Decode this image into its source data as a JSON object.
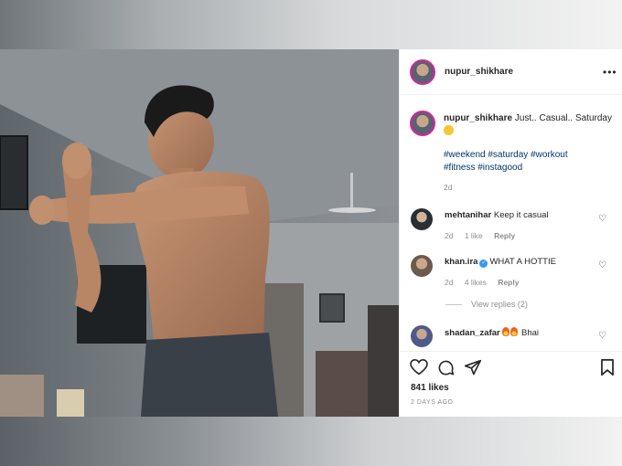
{
  "post": {
    "username": "nupur_shikhare",
    "more_icon": "more-icon",
    "caption": {
      "username": "nupur_shikhare",
      "text": "Just.. Casual.. Saturday",
      "hashtags_line1": "#weekend #saturday #workout",
      "hashtags_line2": "#fitness #instagood",
      "age": "2d"
    },
    "comments": [
      {
        "username": "mehtanihar",
        "text": "Keep it casual",
        "age": "2d",
        "likes": "1 like",
        "reply": "Reply"
      },
      {
        "username": "khan.ira",
        "verified": true,
        "text": "WHAT A HOTTIE",
        "age": "2d",
        "likes": "4 likes",
        "reply": "Reply",
        "view_replies": "View replies (2)"
      },
      {
        "username": "shadan_zafar",
        "text": "Bhai"
      }
    ],
    "likes": "841 likes",
    "posted": "2 DAYS AGO"
  },
  "colors": {
    "link": "#00376b",
    "muted": "#8e8e8e",
    "text": "#262626",
    "verified": "#3897f0"
  }
}
